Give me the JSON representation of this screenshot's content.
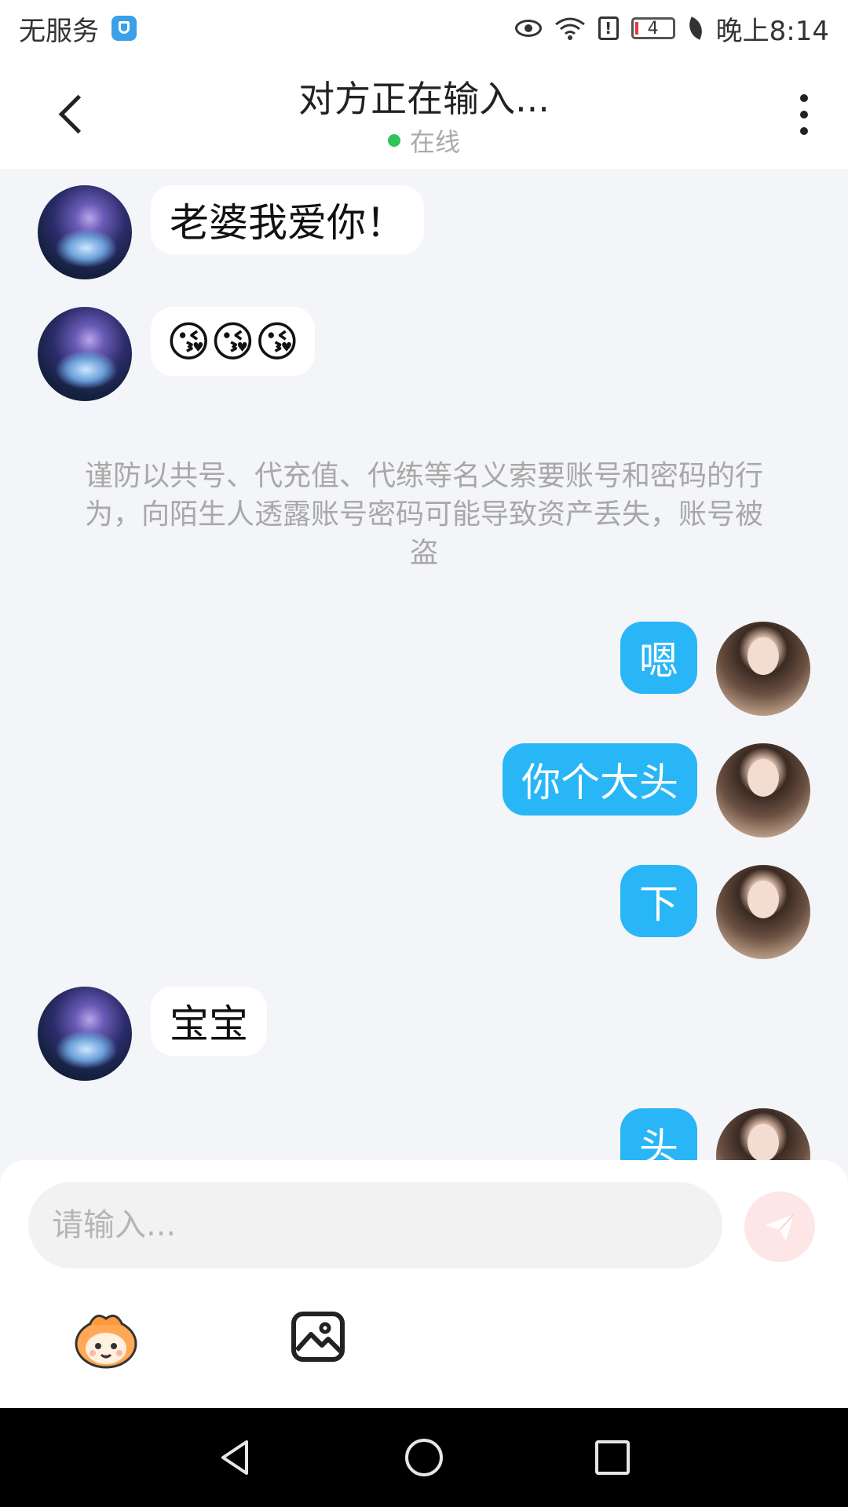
{
  "status_bar": {
    "carrier": "无服务",
    "battery_level": "4",
    "time": "晚上8:14",
    "icons": [
      "shield-icon",
      "eye-icon",
      "wifi-icon",
      "alert-icon",
      "battery-icon",
      "leaf-icon"
    ]
  },
  "header": {
    "title": "对方正在输入...",
    "presence": "在线",
    "presence_color": "#2dc45a"
  },
  "messages": [
    {
      "side": "in",
      "text": "老婆我爱你！"
    },
    {
      "side": "in",
      "text": "😘😘😘"
    },
    {
      "side": "system",
      "text": "谨防以共号、代充值、代练等名义索要账号和密码的行为，向陌生人透露账号密码可能导致资产丢失，账号被盗"
    },
    {
      "side": "out",
      "text": "嗯"
    },
    {
      "side": "out",
      "text": "你个大头"
    },
    {
      "side": "out",
      "text": "下"
    },
    {
      "side": "in",
      "text": "宝宝"
    },
    {
      "side": "out",
      "text": "头"
    }
  ],
  "composer": {
    "placeholder": "请输入...",
    "send_color": "#fde6e6"
  },
  "colors": {
    "outgoing_bubble": "#29b6f6",
    "incoming_bubble": "#ffffff",
    "chat_background": "#f3f5f8"
  }
}
